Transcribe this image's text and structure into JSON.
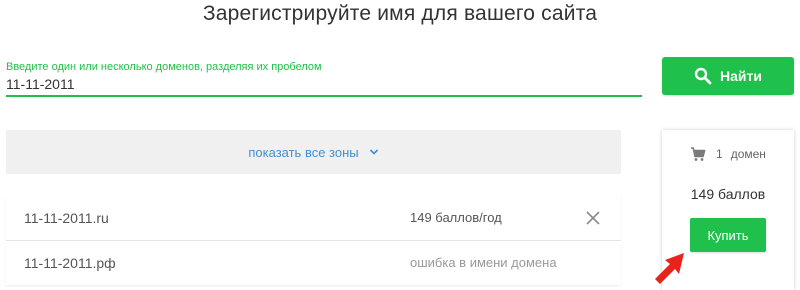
{
  "header": {
    "title": "Зарегистрируйте имя для вашего сайта"
  },
  "search": {
    "label": "Введите один или несколько доменов, разделяя их пробелом",
    "value": "11-11-2011",
    "button_label": "Найти"
  },
  "zones": {
    "toggle_label": "показать все зоны"
  },
  "results": [
    {
      "domain": "11-11-2011.ru",
      "status": "149 баллов/год"
    },
    {
      "domain": "11-11-2011.рф",
      "status": "ошибка в имени домена"
    }
  ],
  "cart": {
    "count": "1",
    "count_unit": "домен",
    "total": "149 баллов",
    "buy_label": "Купить"
  },
  "colors": {
    "accent": "#1fc04b",
    "link": "#3f8fd8",
    "arrow": "#e8231b"
  },
  "icons": [
    "search-icon",
    "chevron-down-icon",
    "close-icon",
    "cart-icon",
    "pointer-arrow-icon"
  ]
}
